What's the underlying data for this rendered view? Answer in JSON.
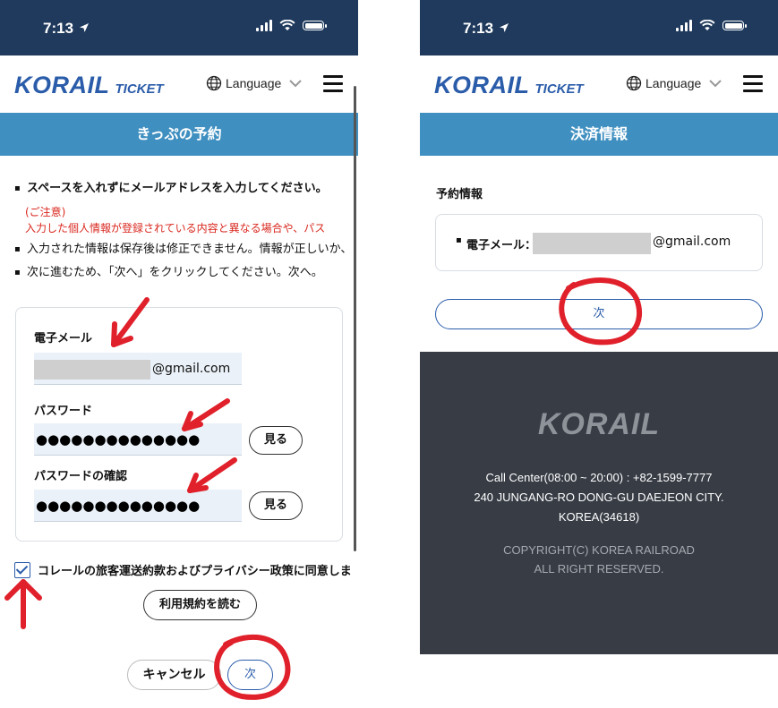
{
  "status": {
    "time": "7:13"
  },
  "app": {
    "logo": "KORAIL",
    "logo_ticket": "TICKET",
    "language": "Language"
  },
  "left": {
    "title": "きっぷの予約",
    "instructions": [
      "スペースを入れずにメールアドレスを入力してください。",
      "入力された情報は保存後は修正できません。情報が正しいか、",
      "次に進むため、「次へ」をクリックしてください。次へ。"
    ],
    "notice_heading": "(ご注意)",
    "notice_text": "入力した個人情報が登録されている内容と異なる場合や、パス",
    "email_label": "電子メール",
    "email_suffix": "@gmail.com",
    "password_label": "パスワード",
    "password_masked": "●●●●●●●●●●●●●●",
    "confirm_label": "パスワードの確認",
    "confirm_masked": "●●●●●●●●●●●●●●",
    "show_label": "見る",
    "agree_text": "コレールの旅客運送約款およびプライバシー政策に同意しま",
    "terms_label": "利用規約を読む",
    "cancel_label": "キャンセル",
    "next_label": "次"
  },
  "right": {
    "title": "決済情報",
    "section_title": "予約情報",
    "email_label": "電子メール：",
    "email_suffix": "@gmail.com",
    "next_label": "次",
    "footer": {
      "logo": "KORAIL",
      "call_center": "Call Center(08:00 ~ 20:00) : +82-1599-7777",
      "address1": "240 JUNGANG-RO DONG-GU DAEJEON CITY.",
      "address2": "KOREA(34618)",
      "copyright1": "COPYRIGHT(C) KOREA RAILROAD",
      "copyright2": "ALL RIGHT RESERVED."
    }
  },
  "colors": {
    "status_bar": "#1f3a5c",
    "title_bar": "#3f8fc0",
    "brand": "#2a5caa",
    "footer": "#373c45",
    "annotation": "#e0202a"
  }
}
